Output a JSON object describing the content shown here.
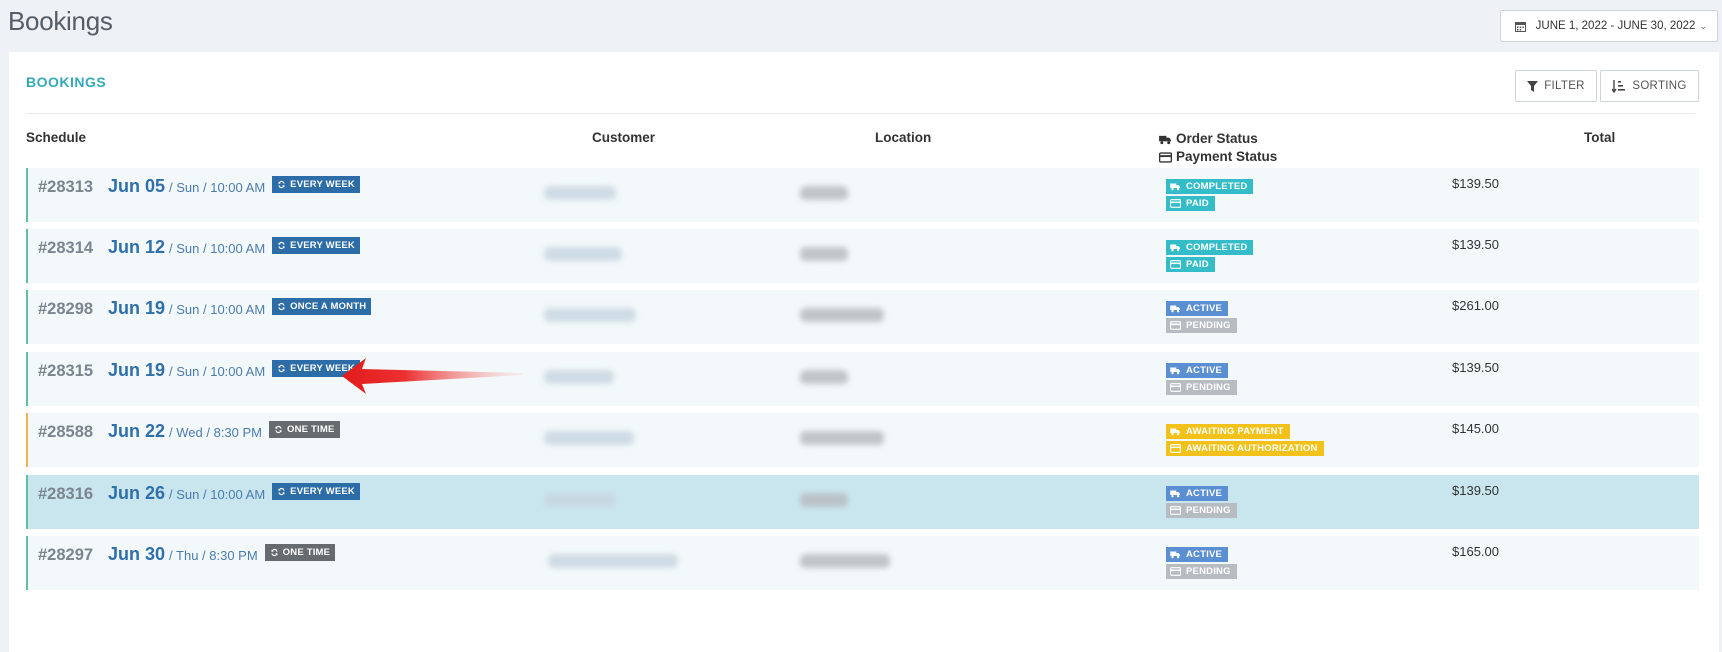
{
  "page": {
    "title": "Bookings"
  },
  "date_range": {
    "label": "JUNE 1, 2022 - JUNE 30, 2022",
    "icon": "calendar-icon",
    "caret": "chevron-down-icon"
  },
  "panel": {
    "title": "BOOKINGS",
    "filter_label": "FILTER",
    "sorting_label": "SORTING"
  },
  "columns": {
    "schedule": "Schedule",
    "customer": "Customer",
    "location": "Location",
    "order_status": "Order Status",
    "payment_status": "Payment Status",
    "total": "Total"
  },
  "colors": {
    "accent": "#36a9b8",
    "link_blue": "#2f6fab",
    "completed": "#34bdc9",
    "active": "#5b8fd3",
    "pending": "#b7bcc3",
    "awaiting": "#f2c21b",
    "highlight_row": "#c9e6ee"
  },
  "rows": [
    {
      "id": "#28313",
      "date": "Jun 05",
      "meta": "/ Sun / 10:00 AM",
      "frequency": "EVERY WEEK",
      "order_status": "COMPLETED",
      "payment_status": "PAID",
      "total": "$139.50"
    },
    {
      "id": "#28314",
      "date": "Jun 12",
      "meta": "/ Sun / 10:00 AM",
      "frequency": "EVERY WEEK",
      "order_status": "COMPLETED",
      "payment_status": "PAID",
      "total": "$139.50"
    },
    {
      "id": "#28298",
      "date": "Jun 19",
      "meta": "/ Sun / 10:00 AM",
      "frequency": "ONCE A MONTH",
      "order_status": "ACTIVE",
      "payment_status": "PENDING",
      "total": "$261.00"
    },
    {
      "id": "#28315",
      "date": "Jun 19",
      "meta": "/ Sun / 10:00 AM",
      "frequency": "EVERY WEEK",
      "order_status": "ACTIVE",
      "payment_status": "PENDING",
      "total": "$139.50"
    },
    {
      "id": "#28588",
      "date": "Jun 22",
      "meta": "/ Wed / 8:30 PM",
      "frequency": "ONE TIME",
      "order_status": "AWAITING PAYMENT",
      "payment_status": "AWAITING AUTHORIZATION",
      "total": "$145.00"
    },
    {
      "id": "#28316",
      "date": "Jun 26",
      "meta": "/ Sun / 10:00 AM",
      "frequency": "EVERY WEEK",
      "order_status": "ACTIVE",
      "payment_status": "PENDING",
      "total": "$139.50"
    },
    {
      "id": "#28297",
      "date": "Jun 30",
      "meta": "/ Thu / 8:30 PM",
      "frequency": "ONE TIME",
      "order_status": "ACTIVE",
      "payment_status": "PENDING",
      "total": "$165.00"
    }
  ]
}
